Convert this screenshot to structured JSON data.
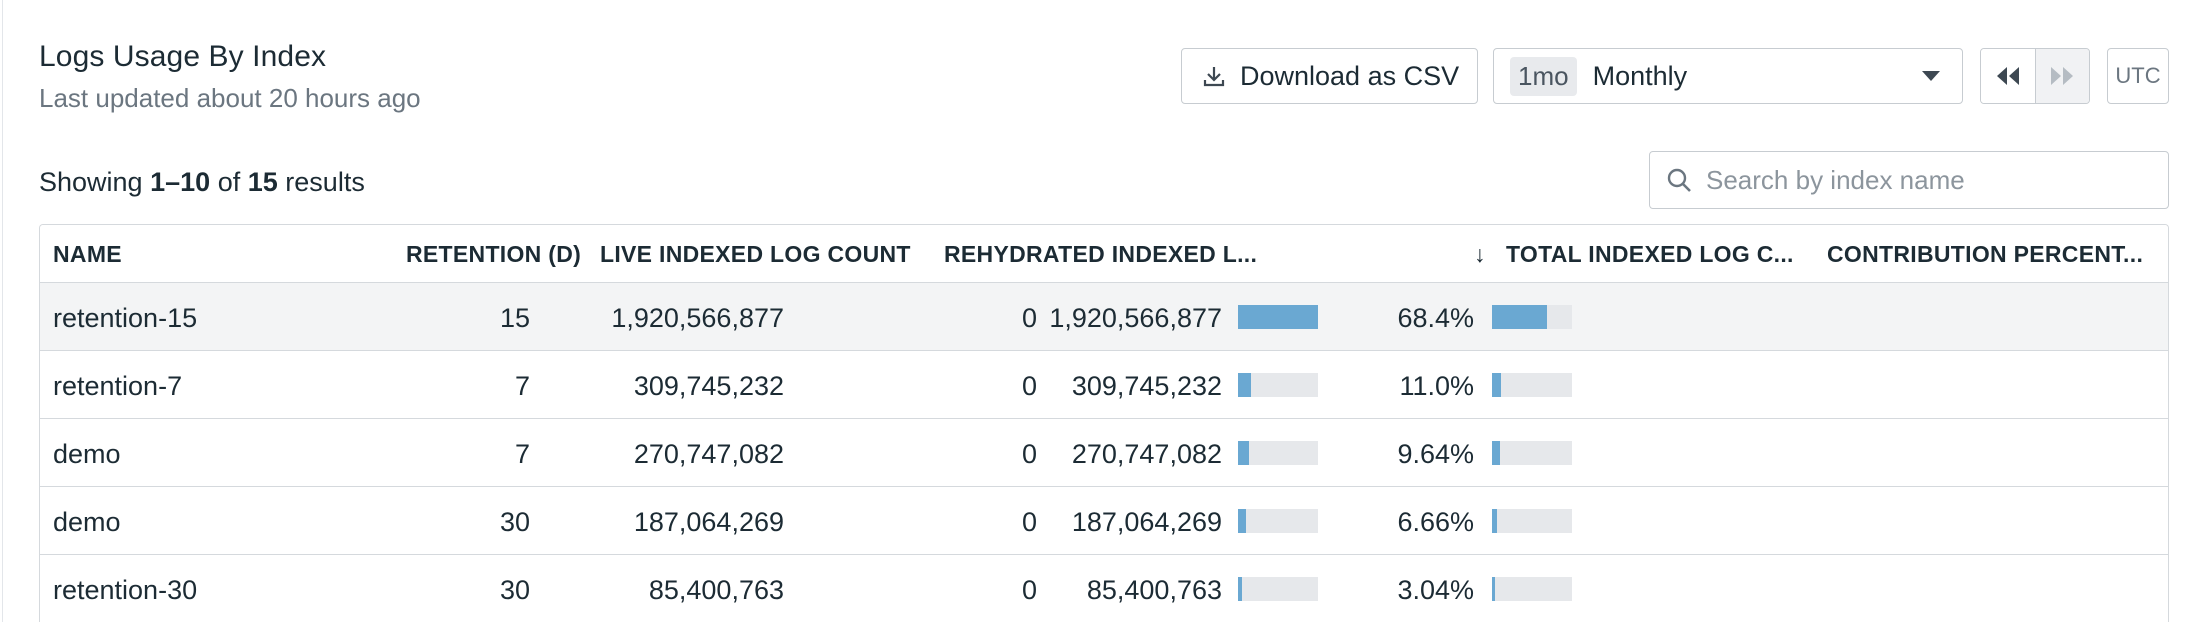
{
  "header": {
    "title": "Logs Usage By Index",
    "subtitle": "Last updated about 20 hours ago"
  },
  "toolbar": {
    "download_label": "Download as CSV",
    "time_badge": "1mo",
    "time_label": "Monthly",
    "timezone": "UTC"
  },
  "results": {
    "prefix": "Showing",
    "range": "1–10",
    "of": "of",
    "total": "15",
    "suffix": "results"
  },
  "search": {
    "placeholder": "Search by index name"
  },
  "table": {
    "columns": [
      "NAME",
      "RETENTION (D)",
      "LIVE INDEXED LOG COUNT",
      "REHYDRATED INDEXED L...",
      "TOTAL INDEXED LOG C...",
      "CONTRIBUTION PERCENT..."
    ],
    "sort_indicator": "↓",
    "rows": [
      {
        "name": "retention-15",
        "retention": "15",
        "live": "1,920,566,877",
        "rehydrated": "0",
        "total": "1,920,566,877",
        "total_fraction": 1.0,
        "contribution": "68.4%",
        "contribution_fraction": 0.684
      },
      {
        "name": "retention-7",
        "retention": "7",
        "live": "309,745,232",
        "rehydrated": "0",
        "total": "309,745,232",
        "total_fraction": 0.161,
        "contribution": "11.0%",
        "contribution_fraction": 0.11
      },
      {
        "name": "demo",
        "retention": "7",
        "live": "270,747,082",
        "rehydrated": "0",
        "total": "270,747,082",
        "total_fraction": 0.141,
        "contribution": "9.64%",
        "contribution_fraction": 0.0964
      },
      {
        "name": "demo",
        "retention": "30",
        "live": "187,064,269",
        "rehydrated": "0",
        "total": "187,064,269",
        "total_fraction": 0.097,
        "contribution": "6.66%",
        "contribution_fraction": 0.0666
      },
      {
        "name": "retention-30",
        "retention": "30",
        "live": "85,400,763",
        "rehydrated": "0",
        "total": "85,400,763",
        "total_fraction": 0.044,
        "contribution": "3.04%",
        "contribution_fraction": 0.0304
      }
    ]
  },
  "icons": {
    "download": "download-icon",
    "search": "search-icon",
    "previous": "rewind-icon",
    "next": "fast-forward-icon",
    "dropdown": "caret-down-icon"
  },
  "colors": {
    "bar_fill": "#6aa8d2",
    "bar_track": "#e6e8eb",
    "highlight_row": "#f3f4f5"
  }
}
